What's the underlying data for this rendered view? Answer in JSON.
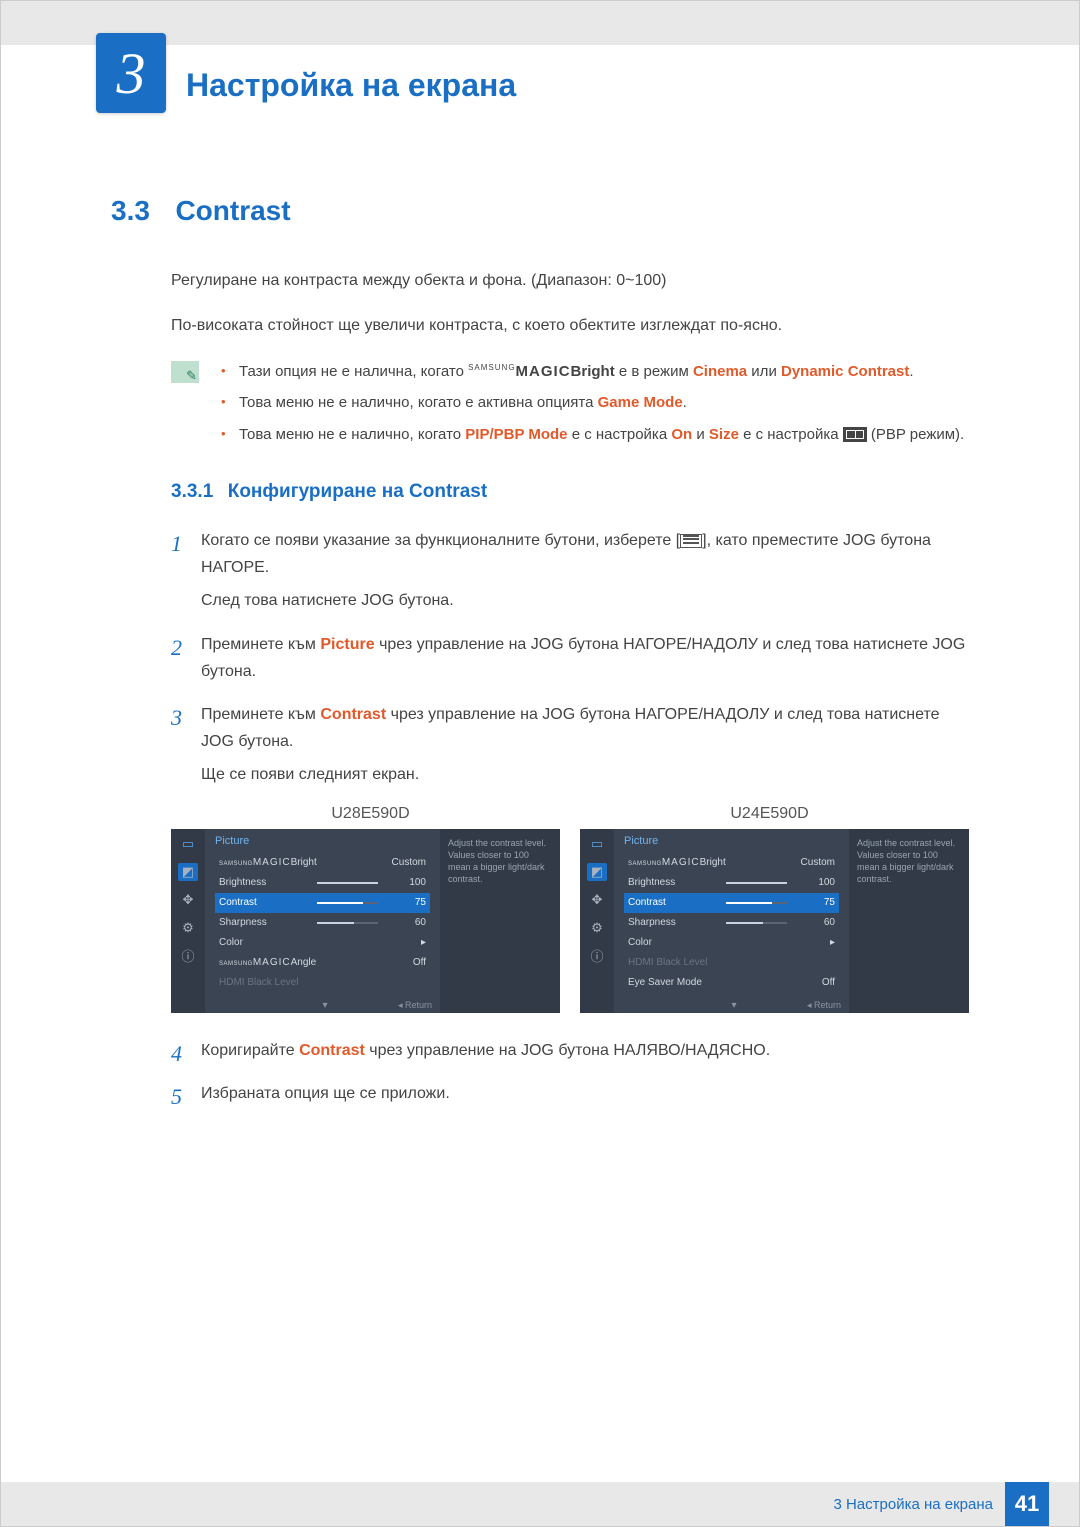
{
  "chapter": {
    "number": "3",
    "title": "Настройка на екрана"
  },
  "section": {
    "number": "3.3",
    "title": "Contrast"
  },
  "desc1": "Регулиране на контраста между обекта и фона. (Диапазон: 0~100)",
  "desc2": "По-високата стойност ще увеличи контраста, с което обектите изглеждат по-ясно.",
  "notes": {
    "n1_a": "Тази опция не е налична, когато ",
    "n1_magic_sup": "SAMSUNG",
    "n1_magic": "MAGIC",
    "n1_bright": "Bright",
    "n1_b": " е в режим ",
    "n1_cinema": "Cinema",
    "n1_c": " или ",
    "n1_dynamic": "Dynamic Contrast",
    "n1_d": ".",
    "n2_a": "Това меню не е налично, когато е активна опцията ",
    "n2_game": "Game Mode",
    "n2_b": ".",
    "n3_a": "Това меню не е налично, когато ",
    "n3_pip": "PIP/PBP Mode",
    "n3_b": " е с настройка ",
    "n3_on": "On",
    "n3_c": " и ",
    "n3_size": "Size",
    "n3_d": " е с настройка ",
    "n3_e": " (PBP режим)."
  },
  "subsection": {
    "number": "3.3.1",
    "title": "Конфигуриране на Contrast"
  },
  "steps": {
    "s1_a": "Когато се появи указание за функционалните бутони, изберете [",
    "s1_b": "], като преместите JOG бутона НАГОРЕ.",
    "s1_c": "След това натиснете JOG бутона.",
    "s2_a": "Преминете към ",
    "s2_pic": "Picture",
    "s2_b": " чрез управление на JOG бутона НАГОРЕ/НАДОЛУ и след това натиснете JOG бутона.",
    "s3_a": "Преминете към ",
    "s3_con": "Contrast",
    "s3_b": " чрез управление на JOG бутона НАГОРЕ/НАДОЛУ и след това натиснете JOG бутона.",
    "s3_c": "Ще се появи следният екран.",
    "s4_a": "Коригирайте ",
    "s4_con": "Contrast",
    "s4_b": " чрез управление на JOG бутона НАЛЯВО/НАДЯСНО.",
    "s5_a": "Избраната опция ще се приложи."
  },
  "step_nums": {
    "n1": "1",
    "n2": "2",
    "n3": "3",
    "n4": "4",
    "n5": "5"
  },
  "models": {
    "left": "U28E590D",
    "right": "U24E590D"
  },
  "osd_help": "Adjust the contrast level. Values closer to 100 mean a bigger light/dark contrast.",
  "osd_return": "Return",
  "osd_return_arrow": "◂",
  "osd_arrow_right": "▸",
  "osd_arrow_down": "▾",
  "osd_left": {
    "title": "Picture",
    "rows": [
      {
        "label_pre": "SAMSUNG",
        "label_main": "MAGIC",
        "label_suf": "Bright",
        "value": "Custom"
      },
      {
        "label": "Brightness",
        "value": "100",
        "pct": 100
      },
      {
        "label": "Contrast",
        "value": "75",
        "pct": 75,
        "selected": true
      },
      {
        "label": "Sharpness",
        "value": "60",
        "pct": 60
      },
      {
        "label": "Color",
        "value": "▸"
      },
      {
        "label_pre": "SAMSUNG",
        "label_main": "MAGIC",
        "label_suf": "Angle",
        "value": "Off"
      },
      {
        "label": "HDMI Black Level",
        "value": "",
        "dim": true
      }
    ]
  },
  "osd_right": {
    "title": "Picture",
    "rows": [
      {
        "label_pre": "SAMSUNG",
        "label_main": "MAGIC",
        "label_suf": "Bright",
        "value": "Custom"
      },
      {
        "label": "Brightness",
        "value": "100",
        "pct": 100
      },
      {
        "label": "Contrast",
        "value": "75",
        "pct": 75,
        "selected": true
      },
      {
        "label": "Sharpness",
        "value": "60",
        "pct": 60
      },
      {
        "label": "Color",
        "value": "▸"
      },
      {
        "label": "HDMI Black Level",
        "value": "",
        "dim": true
      },
      {
        "label": "Eye Saver Mode",
        "value": "Off"
      }
    ]
  },
  "footer": {
    "text": "3 Настройка на екрана",
    "page": "41"
  }
}
